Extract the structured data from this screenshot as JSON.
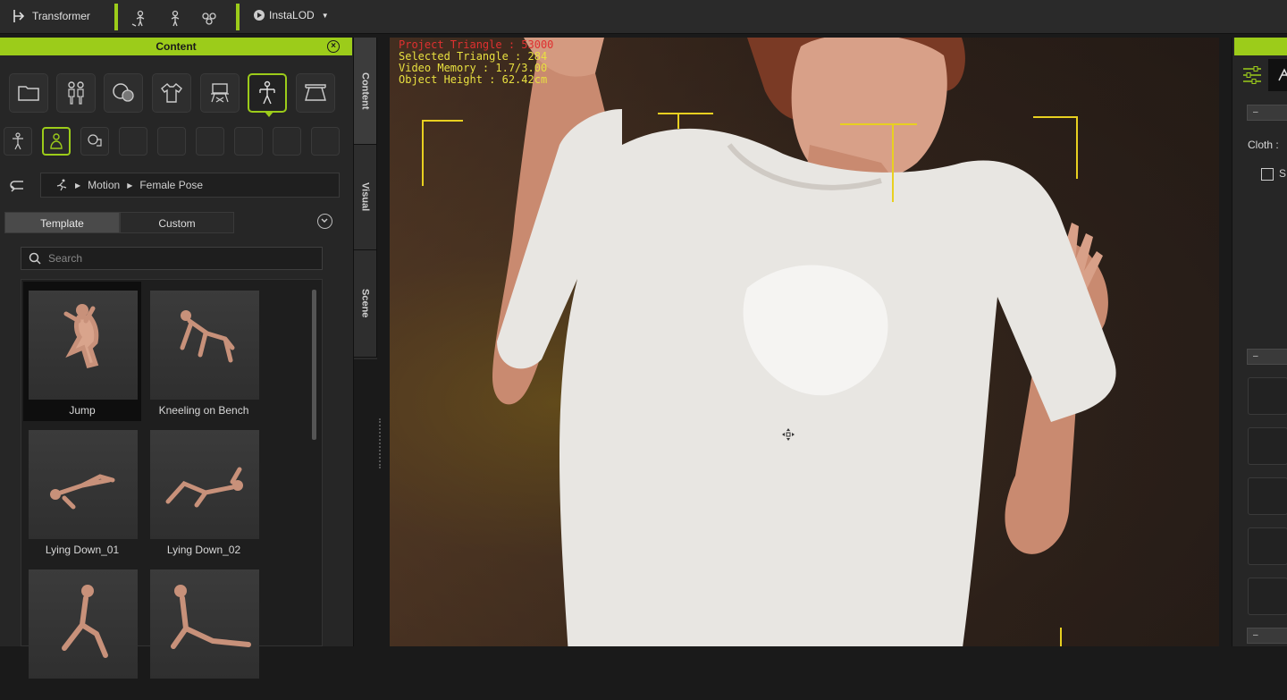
{
  "topbar": {
    "transformer_label": "Transformer",
    "instalod_label": "InstaLOD"
  },
  "content_panel": {
    "header_title": "Content",
    "breadcrumb": [
      "Motion",
      "Female Pose"
    ],
    "tabs": [
      {
        "label": "Template",
        "active": true
      },
      {
        "label": "Custom",
        "active": false
      }
    ],
    "search_placeholder": "Search",
    "items": [
      {
        "label": "Jump",
        "selected": true
      },
      {
        "label": "Kneeling on Bench",
        "selected": false
      },
      {
        "label": "Lying Down_01",
        "selected": false
      },
      {
        "label": "Lying Down_02",
        "selected": false
      },
      {
        "label": "",
        "selected": false
      },
      {
        "label": "",
        "selected": false
      }
    ]
  },
  "side_tabs": [
    {
      "label": "Content",
      "active": true
    },
    {
      "label": "Visual",
      "active": false
    },
    {
      "label": "Scene",
      "active": false
    }
  ],
  "viewport": {
    "stats": {
      "projected_triangle": "Project Triangle : 53000",
      "selected_triangle": "Selected Triangle : 284",
      "video_memory": "Video Memory : 1.7/3.00",
      "object_height": "Object Height : 62.42cm"
    }
  },
  "right_panel": {
    "cloth_label": "Cloth :",
    "checkbox_label": "S"
  },
  "colors": {
    "accent": "#9ccc1a",
    "stats_text": "#e8e040",
    "stats_warning": "#e03030",
    "gizmo": "#e8d020"
  }
}
